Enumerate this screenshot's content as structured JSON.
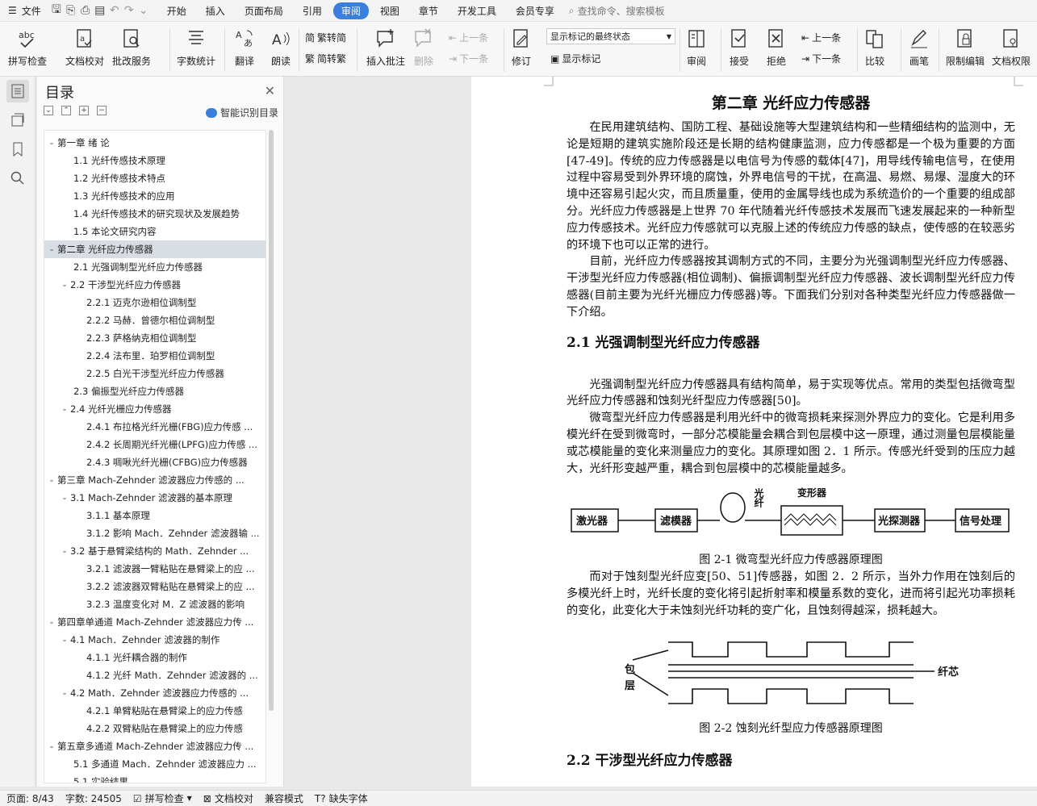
{
  "menu": {
    "file": "文件",
    "tabs": [
      "开始",
      "插入",
      "页面布局",
      "引用",
      "审阅",
      "视图",
      "章节",
      "开发工具",
      "会员专享"
    ],
    "active_tab": "审阅",
    "search": "查找命令、搜索模板"
  },
  "ribbon": {
    "spell": "拼写检查",
    "doc_check": "文档校对",
    "batch": "批改服务",
    "word_count": "字数统计",
    "translate": "翻译",
    "read": "朗读",
    "trad": "繁转简",
    "simp": "简转繁",
    "insert_comment": "插入批注",
    "delete": "删除",
    "prev": "上一条",
    "next": "下一条",
    "track": "修订",
    "markup_select": "显示标记的最终状态",
    "show_markup": "显示标记",
    "review": "审阅",
    "accept": "接受",
    "reject": "拒绝",
    "prev2": "上一条",
    "next2": "下一条",
    "compare": "比较",
    "ink": "画笔",
    "restrict": "限制编辑",
    "rights": "文档权限"
  },
  "toc": {
    "title": "目录",
    "smart": "智能识别目录",
    "items": [
      {
        "t": "第一章 绪   论",
        "lvl": 0,
        "arrow": "v"
      },
      {
        "t": "1.1 光纤传感技术原理",
        "lvl": 1,
        "arrow": ""
      },
      {
        "t": "1.2 光纤传感技术特点",
        "lvl": 1,
        "arrow": ""
      },
      {
        "t": "1.3 光纤传感技术的应用",
        "lvl": 1,
        "arrow": ""
      },
      {
        "t": "1.4 光纤传感技术的研究现状及发展趋势",
        "lvl": 1,
        "arrow": ""
      },
      {
        "t": "1.5 本论文研究内容",
        "lvl": 1,
        "arrow": ""
      },
      {
        "t": "第二章  光纤应力传感器",
        "lvl": 0,
        "arrow": "v",
        "sel": true
      },
      {
        "t": "2.1 光强调制型光纤应力传感器",
        "lvl": 1,
        "arrow": ""
      },
      {
        "t": "2.2 干涉型光纤应力传感器",
        "lvl": 1,
        "arrow": "v"
      },
      {
        "t": "2.2.1  迈克尔逊相位调制型",
        "lvl": 2,
        "arrow": ""
      },
      {
        "t": "2.2.2 马赫．曾德尔相位调制型",
        "lvl": 2,
        "arrow": ""
      },
      {
        "t": "2.2.3  萨格纳克相位调制型",
        "lvl": 2,
        "arrow": ""
      },
      {
        "t": "2.2.4 法布里．珀罗相位调制型",
        "lvl": 2,
        "arrow": ""
      },
      {
        "t": "2.2.5 白光干涉型光纤应力传感器",
        "lvl": 2,
        "arrow": ""
      },
      {
        "t": "2.3 偏振型光纤应力传感器",
        "lvl": 1,
        "arrow": ""
      },
      {
        "t": "2.4 光纤光栅应力传感器",
        "lvl": 1,
        "arrow": "v"
      },
      {
        "t": "2.4.1 布拉格光纤光栅(FBG)应力传感 ...",
        "lvl": 2,
        "arrow": ""
      },
      {
        "t": "2.4.2 长周期光纤光栅(LPFG)应力传感 ...",
        "lvl": 2,
        "arrow": ""
      },
      {
        "t": "2.4.3 啁啾光纤光栅(CFBG)应力传感器",
        "lvl": 2,
        "arrow": ""
      },
      {
        "t": "第三章  Mach-Zehnder 滤波器应力传感的 ...",
        "lvl": 0,
        "arrow": "v"
      },
      {
        "t": "3.1 Mach-Zehnder 滤波器的基本原理",
        "lvl": 1,
        "arrow": "v"
      },
      {
        "t": "3.1.1  基本原理",
        "lvl": 2,
        "arrow": ""
      },
      {
        "t": "3.1.2 影响 Mach．Zehnder 滤波器输 ...",
        "lvl": 2,
        "arrow": ""
      },
      {
        "t": "3.2  基于悬臂梁结构的 Math．Zehnder ...",
        "lvl": 1,
        "arrow": "v"
      },
      {
        "t": "3.2.1  滤波器一臂粘贴在悬臂梁上的应 ...",
        "lvl": 2,
        "arrow": ""
      },
      {
        "t": "3.2.2  滤波器双臂粘贴在悬臂梁上的应 ...",
        "lvl": 2,
        "arrow": ""
      },
      {
        "t": "3.2.3  温度变化对 M．Z 滤波器的影响",
        "lvl": 2,
        "arrow": ""
      },
      {
        "t": "第四章单通道 Mach-Zehnder 滤波器应力传 ...",
        "lvl": 0,
        "arrow": "v"
      },
      {
        "t": "4.1 Mach．Zehnder 滤波器的制作",
        "lvl": 1,
        "arrow": "v"
      },
      {
        "t": "4.1.1  光纤耦合器的制作",
        "lvl": 2,
        "arrow": ""
      },
      {
        "t": "4.1.2 光纤 Math．Zehnder 滤波器的 ...",
        "lvl": 2,
        "arrow": ""
      },
      {
        "t": "4.2 Math．Zehnder 滤波器应力传感的 ...",
        "lvl": 1,
        "arrow": "v"
      },
      {
        "t": "4.2.1 单臂粘贴在悬臂梁上的应力传感",
        "lvl": 2,
        "arrow": ""
      },
      {
        "t": "4.2.2 双臂粘贴在悬臂梁上的应力传感",
        "lvl": 2,
        "arrow": ""
      },
      {
        "t": "第五章多通道 Mach-Zehnder 滤波器应力传 ...",
        "lvl": 0,
        "arrow": "v"
      },
      {
        "t": "5.1  多通道 Mach．Zehnder 滤波器应力 ...",
        "lvl": 1,
        "arrow": ""
      },
      {
        "t": "5.1  实验结果",
        "lvl": 1,
        "arrow": ""
      }
    ]
  },
  "doc": {
    "chapter_title": "第二章  光纤应力传感器",
    "p1": "在民用建筑结构、国防工程、基础设施等大型建筑结构和一些精细结构的监测中，无论是短期的建筑实施阶段还是长期的结构健康监测，应力传感都是一个极为重要的方面[47-49]。传统的应力传感器是以电信号为传感的载体[47]，用导线传输电信号，在使用过程中容易受到外界环境的腐蚀，外界电信号的干扰，在高温、易燃、易爆、湿度大的环境中还容易引起火灾，而且质量重，使用的金属导线也成为系统造价的一个重要的组成部分。光纤应力传感器是上世界 70 年代随着光纤传感技术发展而飞速发展起来的一种新型应力传感技术。光纤应力传感就可以克服上述的传统应力传感的缺点，使传感的在较恶劣的环境下也可以正常的进行。",
    "p2": "目前，光纤应力传感器按其调制方式的不同，主要分为光强调制型光纤应力传感器、干涉型光纤应力传感器(相位调制)、偏振调制型光纤应力传感器、波长调制型光纤应力传感器(目前主要为光纤光栅应力传感器)等。下面我们分别对各种类型光纤应力传感器做一下介绍。",
    "sec21": "2.1 光强调制型光纤应力传感器",
    "p3": "光强调制型光纤应力传感器具有结构简单，易于实现等优点。常用的类型包括微弯型光纤应力传感器和蚀刻光纤型应力传感器[50]。",
    "p4": "微弯型光纤应力传感器是利用光纤中的微弯损耗来探测外界应力的变化。它是利用多模光纤在受到微弯时，一部分芯模能量会耦合到包层模中这一原理，通过测量包层模能量或芯模能量的变化来测量应力的变化。其原理如图 2．1 所示。传感光纤受到的压应力越大，光纤形变越严重，耦合到包层模中的芯模能量越多。",
    "fig1": {
      "laser": "激光器",
      "filter": "滤模器",
      "fiber": "光纤",
      "deformer": "变形器",
      "detector": "光探测器",
      "processor": "信号处理",
      "caption": "图 2-1 微弯型光纤应力传感器原理图"
    },
    "p5": "而对于蚀刻型光纤应变[50、51]传感器，如图 2．2 所示，当外力作用在蚀刻后的多模光纤上时，光纤长度的变化将引起折射率和模量系数的变化，进而将引起光功率损耗的变化，此变化大于未蚀刻光纤功耗的变广化，且蚀刻得越深，损耗越大。",
    "fig2": {
      "cladding1": "包",
      "cladding2": "层",
      "core": "纤芯",
      "caption": "图 2-2 蚀刻光纤型应力传感器原理图"
    },
    "sec22": "2.2 干涉型光纤应力传感器"
  },
  "status": {
    "page": "页面: 8/43",
    "words": "字数: 24505",
    "spell": "拼写检查",
    "check": "文档校对",
    "compat": "兼容模式",
    "missing_font": "缺失字体"
  }
}
